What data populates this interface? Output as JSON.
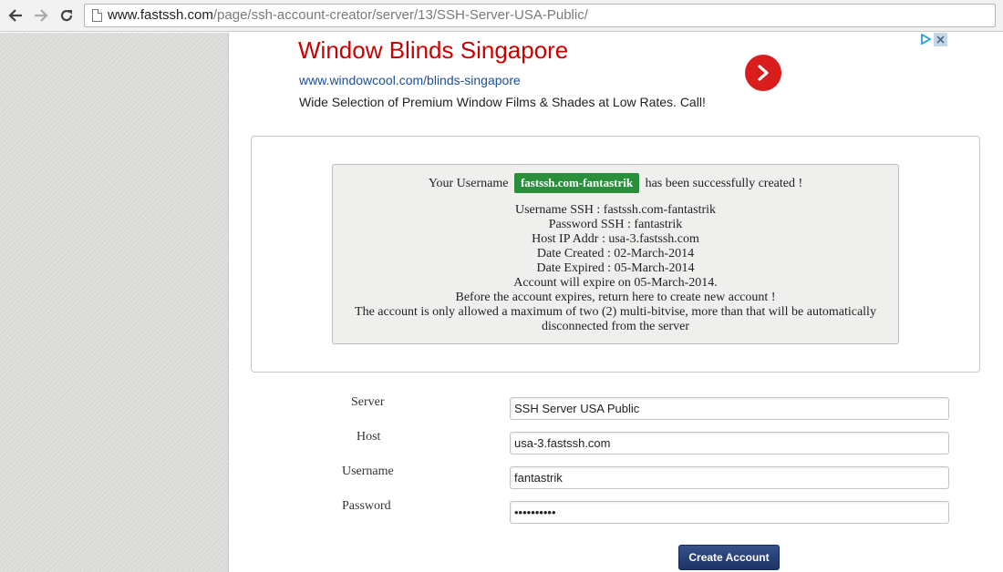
{
  "browser": {
    "url_domain": "www.fastssh.com",
    "url_path": "/page/ssh-account-creator/server/13/SSH-Server-USA-Public/"
  },
  "ad": {
    "title": "Window Blinds Singapore",
    "url": "www.windowcool.com/blinds-singapore",
    "description": "Wide Selection of Premium Window Films & Shades at Low Rates. Call!"
  },
  "result": {
    "prefix": "Your Username",
    "username_badge": "fastssh.com-fantastrik",
    "suffix": "has been successfully created !",
    "lines": [
      "Username SSH : fastssh.com-fantastrik",
      "Password SSH : fantastrik",
      "Host IP Addr : usa-3.fastssh.com",
      "Date Created : 02-March-2014",
      "Date Expired : 05-March-2014",
      "Account will expire on 05-March-2014.",
      "Before the account expires, return here to create new account !",
      "The account is only allowed a maximum of two (2) multi-bitvise, more than that will be automatically disconnected from the server"
    ]
  },
  "form": {
    "server_label": "Server",
    "server_value": "SSH Server USA Public",
    "host_label": "Host",
    "host_value": "usa-3.fastssh.com",
    "username_label": "Username",
    "username_value": "fantastrik",
    "password_label": "Password",
    "password_value": "fantastrik",
    "submit_label": "Create Account"
  },
  "colors": {
    "ad_title": "#cc0000",
    "ad_url": "#1a4f9c",
    "badge": "#2a8f3a",
    "button": "#1c3366"
  }
}
